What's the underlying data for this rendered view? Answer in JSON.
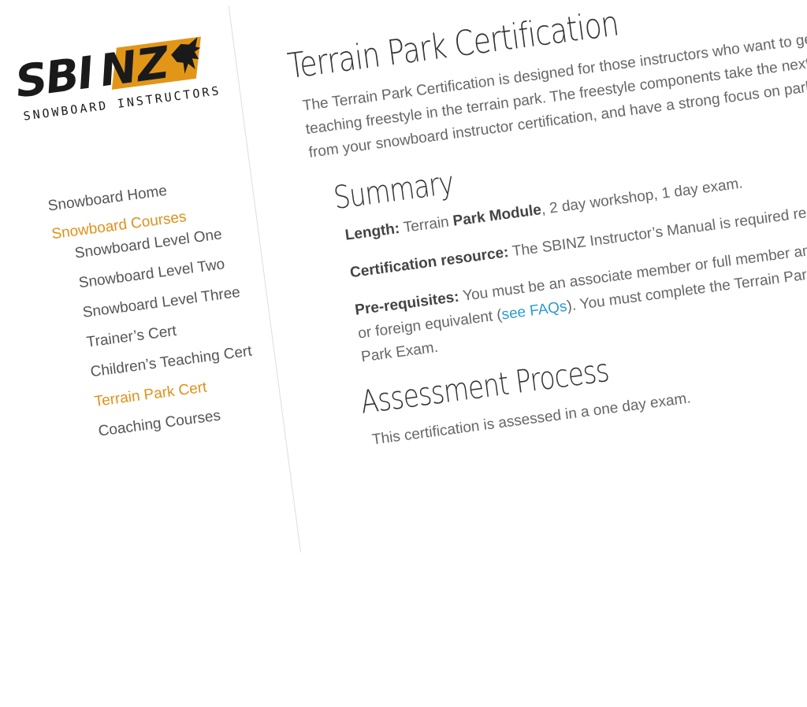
{
  "logo": {
    "wordmark_left": "SBI",
    "wordmark_right": "NZ",
    "subtitle": "SNOWBOARD INSTRUCTORS",
    "accent_color": "#e29618"
  },
  "nav": {
    "items": [
      {
        "label": "Snowboard Home",
        "level": "top",
        "active": false
      },
      {
        "label": "Snowboard Courses",
        "level": "top",
        "active": true
      },
      {
        "label": "Snowboard Level One",
        "level": "sub",
        "active": false
      },
      {
        "label": "Snowboard Level Two",
        "level": "sub",
        "active": false
      },
      {
        "label": "Snowboard Level Three",
        "level": "sub",
        "active": false
      },
      {
        "label": "Trainer’s Cert",
        "level": "sub",
        "active": false
      },
      {
        "label": "Children’s Teaching Cert",
        "level": "sub",
        "active": false
      },
      {
        "label": "Terrain Park Cert",
        "level": "sub",
        "active": true
      },
      {
        "label": "Coaching Courses",
        "level": "sub",
        "active": false
      }
    ],
    "active_color": "#e0901a"
  },
  "main": {
    "title": "Terrain Park Certification",
    "intro": "The Terrain Park Certification is designed for those instructors who want to get into teaching freestyle in the terrain park. The freestyle components take the next step up from your snowboard instructor certification, and have a strong focus on park safety and",
    "summary": {
      "title": "Summary",
      "length_label": "Length:",
      "length_pre": "Terrain",
      "length_bold": "Park Module",
      "length_post": ", 2 day workshop, 1 day exam.",
      "resource_label": "Certification resource:",
      "resource_text": "The SBINZ Instructor’s Manual is required reading",
      "prereq_label": "Pre-requisites:",
      "prereq_text_1": "You must be an associate member or full member and h",
      "prereq_text_2": "or foreign equivalent (",
      "prereq_link": "see FAQs",
      "prereq_text_3": "). You must complete the Terrain Park W",
      "prereq_text_4": "Park Exam."
    },
    "assessment": {
      "title": "Assessment Process",
      "text": "This certification is assessed in a one day exam."
    },
    "link_color": "#2a9bd3"
  }
}
